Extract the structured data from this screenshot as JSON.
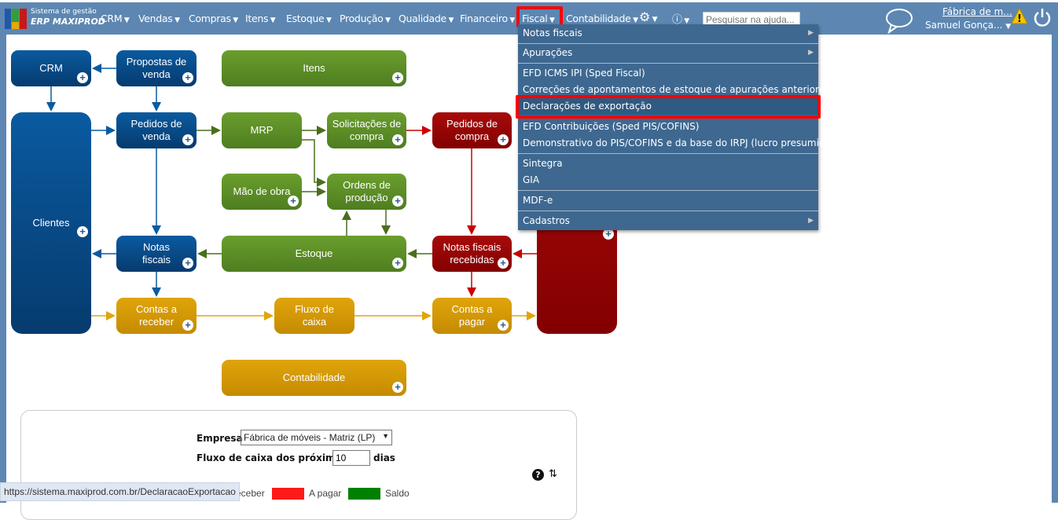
{
  "header": {
    "brand_line1": "Sistema de gestão",
    "brand_line2": "ERP MAXIPROD",
    "nav": [
      "CRM",
      "Vendas",
      "Compras",
      "Itens",
      "Estoque",
      "Produção",
      "Qualidade",
      "Financeiro",
      "Fiscal",
      "Contabilidade"
    ],
    "search_placeholder": "Pesquisar na ajuda...",
    "company": "Fábrica de m...",
    "user": "Samuel Gonça...",
    "icons": [
      "gear-icon",
      "help-icon",
      "chat-icon",
      "warning-icon",
      "power-icon"
    ]
  },
  "fiscal_menu": [
    {
      "label": "Notas fiscais",
      "submenu": true
    },
    {
      "label": "Apurações",
      "submenu": true
    },
    {
      "label": "EFD ICMS IPI (Sped Fiscal)"
    },
    {
      "label": "Correções de apontamentos de estoque de apurações anteriores"
    },
    {
      "label": "Declarações de exportação",
      "highlighted": true
    },
    {
      "label": "EFD Contribuições (Sped PIS/COFINS)"
    },
    {
      "label": "Demonstrativo do PIS/COFINS e da base do IRPJ (lucro presumido)"
    },
    {
      "label": "Sintegra"
    },
    {
      "label": "GIA"
    },
    {
      "label": "MDF-e"
    },
    {
      "label": "Cadastros",
      "submenu": true
    }
  ],
  "flow": {
    "crm": "CRM",
    "propostas": "Propostas de venda",
    "itens": "Itens",
    "clientes": "Clientes",
    "pedidos_venda": "Pedidos de venda",
    "mrp": "MRP",
    "solicitacoes": "Solicitações de compra",
    "pedidos_compra": "Pedidos de compra",
    "mao_obra": "Mão de obra",
    "ordens": "Ordens de produção",
    "notas": "Notas fiscais",
    "estoque": "Estoque",
    "notas_recebidas": "Notas fiscais recebidas",
    "receber": "Contas a receber",
    "fluxo": "Fluxo de caixa",
    "pagar": "Contas a pagar",
    "contabilidade": "Contabilidade"
  },
  "colors": {
    "blue": "#0a5aa0",
    "green": "#6a9e2d",
    "red": "#a80b0b",
    "gold": "#e0a50b",
    "header": "#5d87b2",
    "menu": "#3e6890"
  },
  "panel": {
    "empresa_label": "Empresa",
    "empresa_value": "Fábrica de móveis - Matriz (LP)",
    "fluxo_label": "Fluxo de caixa dos próximos",
    "dias_value": "10",
    "dias_label": "dias",
    "legend": [
      {
        "label": "eceber"
      },
      {
        "label": "A pagar",
        "color": "#ff1a1a"
      },
      {
        "label": "Saldo",
        "color": "#008000"
      }
    ]
  },
  "status_url": "https://sistema.maxiprod.com.br/DeclaracaoExportacao"
}
